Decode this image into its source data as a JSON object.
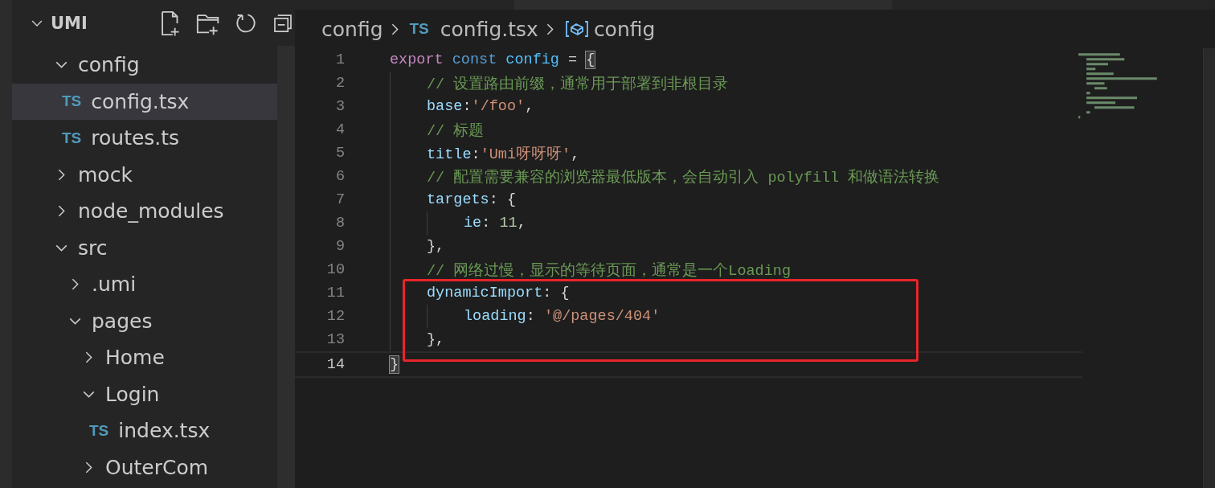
{
  "explorer": {
    "title": "UMI",
    "expanded": true,
    "tree": [
      {
        "label": "config",
        "kind": "folder",
        "expanded": true,
        "selected": false,
        "children": [
          {
            "label": "config.tsx",
            "kind": "file",
            "badge": "TS",
            "selected": true
          },
          {
            "label": "routes.ts",
            "kind": "file",
            "badge": "TS",
            "selected": false
          }
        ]
      },
      {
        "label": "mock",
        "kind": "folder",
        "expanded": false,
        "selected": false
      },
      {
        "label": "node_modules",
        "kind": "folder",
        "expanded": false,
        "selected": false
      },
      {
        "label": "src",
        "kind": "folder",
        "expanded": true,
        "selected": false,
        "children": [
          {
            "label": ".umi",
            "kind": "folder",
            "expanded": false,
            "selected": false
          },
          {
            "label": "pages",
            "kind": "folder",
            "expanded": true,
            "selected": false,
            "children": [
              {
                "label": "Home",
                "kind": "folder",
                "expanded": false,
                "selected": false
              },
              {
                "label": "Login",
                "kind": "folder",
                "expanded": true,
                "selected": false,
                "children": [
                  {
                    "label": "index.tsx",
                    "kind": "file",
                    "badge": "TS",
                    "selected": false
                  }
                ]
              },
              {
                "label": "OuterCom",
                "kind": "folder",
                "expanded": false,
                "selected": false
              }
            ]
          }
        ]
      }
    ]
  },
  "breadcrumb": [
    {
      "kind": "folder",
      "label": "config"
    },
    {
      "kind": "file",
      "badge": "TS",
      "label": "config.tsx"
    },
    {
      "kind": "symbol",
      "label": "config"
    }
  ],
  "code": [
    {
      "number": "1",
      "current": false,
      "boxed": false,
      "tokens": [
        {
          "kind": "keyword",
          "text": "export"
        },
        {
          "kind": "storage",
          "text": " const"
        },
        {
          "kind": "variable",
          "text": " config"
        },
        {
          "kind": "plain",
          "text": " = "
        },
        {
          "kind": "bracket",
          "text": "{"
        }
      ],
      "children": [
        {
          "number": "2",
          "current": false,
          "boxed": false,
          "tokens": [
            {
              "kind": "comment",
              "text": "// 设置路由前缀，通常用于部署到非根目录"
            }
          ]
        },
        {
          "number": "3",
          "current": false,
          "boxed": false,
          "tokens": [
            {
              "kind": "property",
              "text": "base"
            },
            {
              "kind": "plain",
              "text": ":"
            },
            {
              "kind": "string",
              "text": "'/foo'"
            },
            {
              "kind": "plain",
              "text": ","
            }
          ]
        },
        {
          "number": "4",
          "current": false,
          "boxed": false,
          "tokens": [
            {
              "kind": "comment",
              "text": "// 标题"
            }
          ]
        },
        {
          "number": "5",
          "current": false,
          "boxed": false,
          "tokens": [
            {
              "kind": "property",
              "text": "title"
            },
            {
              "kind": "plain",
              "text": ":"
            },
            {
              "kind": "string",
              "text": "'Umi呀呀呀'"
            },
            {
              "kind": "plain",
              "text": ","
            }
          ]
        },
        {
          "number": "6",
          "current": false,
          "boxed": false,
          "tokens": [
            {
              "kind": "comment",
              "text": "// 配置需要兼容的浏览器最低版本，会自动引入 polyfill 和做语法转换"
            }
          ]
        },
        {
          "number": "7",
          "current": false,
          "boxed": false,
          "tokens": [
            {
              "kind": "property",
              "text": "targets"
            },
            {
              "kind": "plain",
              "text": ": {"
            }
          ],
          "children": [
            {
              "number": "8",
              "current": false,
              "boxed": false,
              "tokens": [
                {
                  "kind": "property",
                  "text": "ie"
                },
                {
                  "kind": "plain",
                  "text": ": "
                },
                {
                  "kind": "number",
                  "text": "11"
                },
                {
                  "kind": "plain",
                  "text": ","
                }
              ]
            }
          ]
        },
        {
          "number": "9",
          "current": false,
          "boxed": false,
          "tokens": [
            {
              "kind": "plain",
              "text": "},"
            }
          ]
        },
        {
          "number": "10",
          "current": false,
          "boxed": false,
          "tokens": [
            {
              "kind": "comment",
              "text": "// 网络过慢，显示的等待页面，通常是一个Loading"
            }
          ]
        },
        {
          "number": "11",
          "current": false,
          "boxed": true,
          "tokens": [
            {
              "kind": "property",
              "text": "dynamicImport"
            },
            {
              "kind": "plain",
              "text": ": {"
            }
          ],
          "children": [
            {
              "number": "12",
              "current": false,
              "boxed": true,
              "tokens": [
                {
                  "kind": "property",
                  "text": "loading"
                },
                {
                  "kind": "plain",
                  "text": ": "
                },
                {
                  "kind": "string",
                  "text": "'@/pages/404'"
                }
              ]
            }
          ]
        },
        {
          "number": "13",
          "current": false,
          "boxed": true,
          "tokens": [
            {
              "kind": "plain",
              "text": "},"
            }
          ]
        }
      ]
    },
    {
      "number": "14",
      "current": true,
      "boxed": false,
      "tokens": [
        {
          "kind": "bracket",
          "text": "}"
        }
      ]
    }
  ],
  "highlight_box": {
    "color": "#e8252a"
  }
}
